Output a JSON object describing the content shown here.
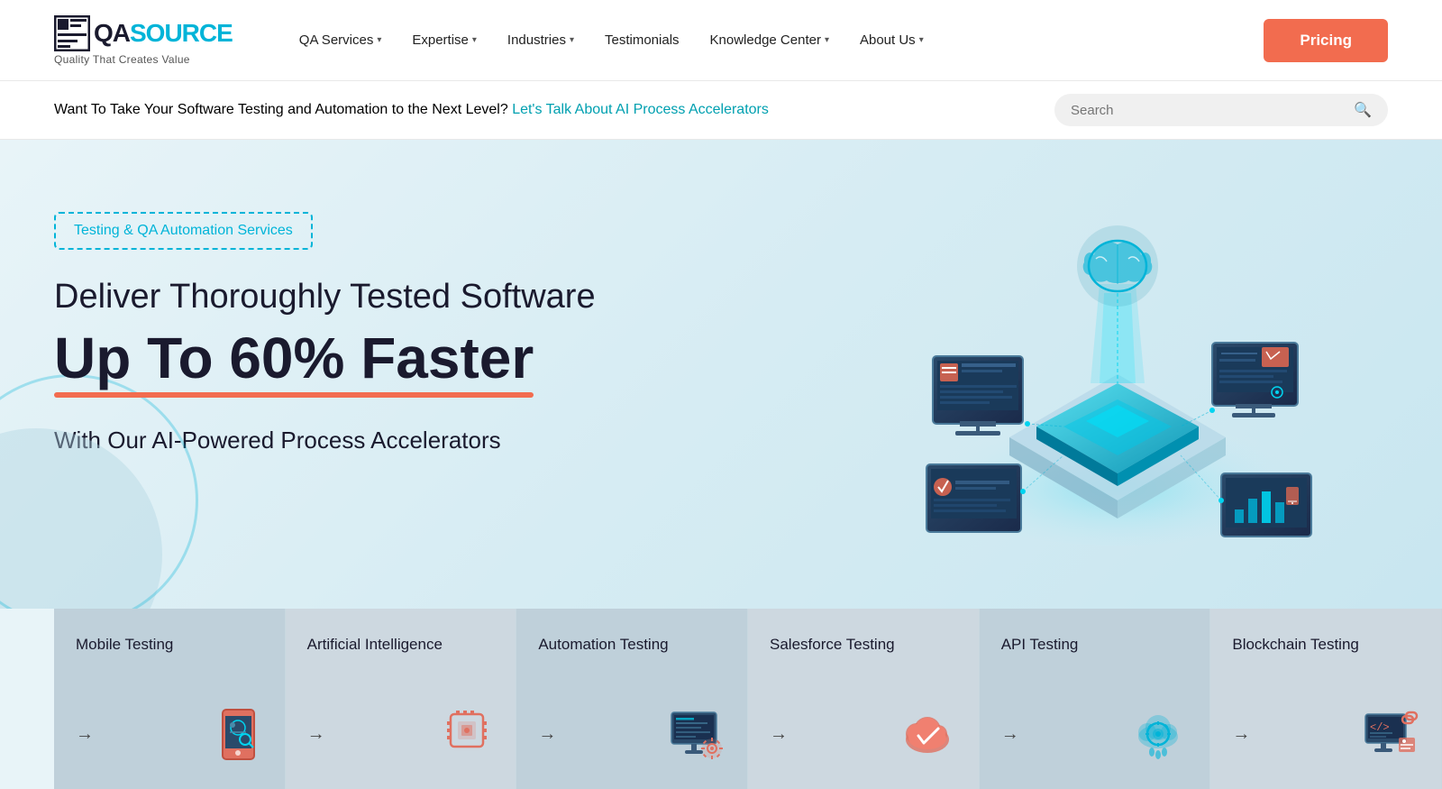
{
  "header": {
    "logo": {
      "qa": "QA",
      "source": "SOURCE",
      "tagline": "Quality That Creates Value"
    },
    "nav": [
      {
        "label": "QA Services",
        "hasDropdown": true,
        "id": "qa-services"
      },
      {
        "label": "Expertise",
        "hasDropdown": true,
        "id": "expertise"
      },
      {
        "label": "Industries",
        "hasDropdown": true,
        "id": "industries"
      },
      {
        "label": "Testimonials",
        "hasDropdown": false,
        "id": "testimonials"
      },
      {
        "label": "Knowledge Center",
        "hasDropdown": true,
        "id": "knowledge-center"
      },
      {
        "label": "About Us",
        "hasDropdown": true,
        "id": "about-us"
      }
    ],
    "pricing_label": "Pricing"
  },
  "announcement": {
    "text": "Want To Take Your Software Testing and Automation to the Next Level?",
    "link_text": "Let's Talk About AI Process Accelerators",
    "link_href": "#"
  },
  "search": {
    "placeholder": "Search"
  },
  "hero": {
    "badge": "Testing & QA Automation Services",
    "title_line1": "Deliver Thoroughly Tested Software",
    "title_line2": "Up To 60% Faster",
    "subtitle": "With Our AI-Powered Process Accelerators"
  },
  "service_cards": [
    {
      "title": "Mobile Testing",
      "arrow": "→",
      "icon": "📱"
    },
    {
      "title": "Artificial Intelligence",
      "arrow": "→",
      "icon": "🤖"
    },
    {
      "title": "Automation Testing",
      "arrow": "→",
      "icon": "⚙️"
    },
    {
      "title": "Salesforce Testing",
      "arrow": "→",
      "icon": "☁️"
    },
    {
      "title": "API Testing",
      "arrow": "→",
      "icon": "🔧"
    },
    {
      "title": "Blockchain Testing",
      "arrow": "→",
      "icon": "🔗"
    }
  ],
  "colors": {
    "accent_teal": "#00b4d8",
    "accent_red": "#f26c4f",
    "dark": "#1a1a2e",
    "bg_light": "#e8f4f8"
  }
}
